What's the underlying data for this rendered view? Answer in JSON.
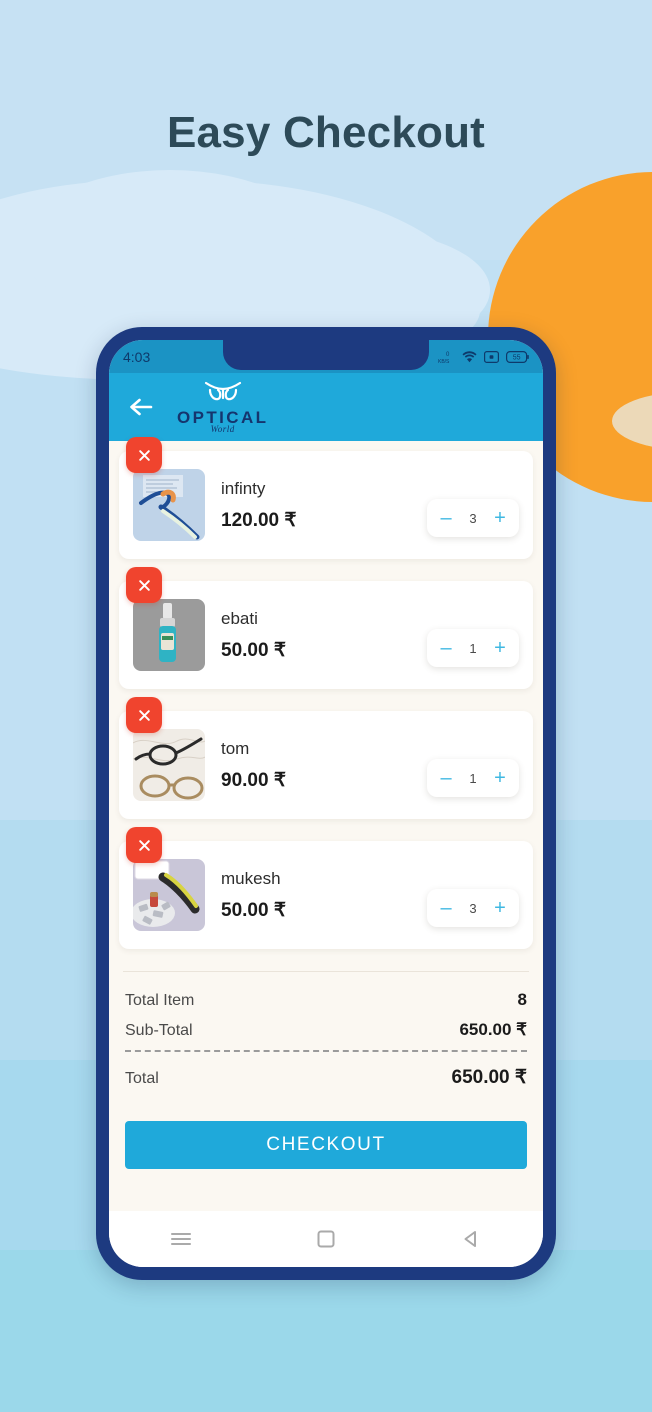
{
  "page": {
    "headline": "Easy Checkout",
    "headline_color": "#2d4a58",
    "background_color": "#c3e0f2",
    "sun_color": "#f9a12b"
  },
  "phone": {
    "frame_color": "#1d3a80",
    "screen_background": "#fbf8f2"
  },
  "statusbar": {
    "time": "4:03",
    "battery_level": "55",
    "icons": [
      "network-speed-icon",
      "wifi-icon",
      "screen-record-icon",
      "battery-icon"
    ]
  },
  "appbar": {
    "back_icon": "back-arrow-icon",
    "brand": "OPTICAL",
    "brand_sub": "World",
    "background_color": "#1fa9da"
  },
  "cart": {
    "items": [
      {
        "name": "infinty",
        "price": "120.00 ₹",
        "quantity": "3",
        "thumb": "eyeglasses-blue-frame",
        "remove_icon": "close-icon"
      },
      {
        "name": "ebati",
        "price": "50.00 ₹",
        "quantity": "1",
        "thumb": "lens-spray-bottle",
        "remove_icon": "close-icon"
      },
      {
        "name": "tom",
        "price": "90.00 ₹",
        "quantity": "1",
        "thumb": "eyeglasses-assortment",
        "remove_icon": "close-icon"
      },
      {
        "name": "mukesh",
        "price": "50.00 ₹",
        "quantity": "3",
        "thumb": "sunglasses-on-ice",
        "remove_icon": "close-icon"
      }
    ],
    "minus_label": "–",
    "plus_label": "+"
  },
  "totals": {
    "total_item_label": "Total Item",
    "total_item_value": "8",
    "subtotal_label": "Sub-Total",
    "subtotal_value": "650.00 ₹",
    "total_label": "Total",
    "total_value": "650.00 ₹"
  },
  "checkout": {
    "label": "CHECKOUT",
    "color": "#1fa9da"
  },
  "navbar": {
    "items": [
      "menu-icon",
      "home-square-icon",
      "back-triangle-icon"
    ]
  }
}
